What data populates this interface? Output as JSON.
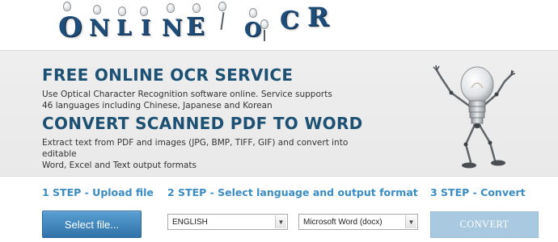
{
  "logo": {
    "letters": [
      "O",
      "N",
      "L",
      "I",
      "N",
      "E",
      "O",
      "C",
      "R"
    ]
  },
  "hero": {
    "title1": "FREE ONLINE OCR SERVICE",
    "text1_line1": "Use Optical Character Recognition software online. Service supports",
    "text1_line2": "46 languages including Chinese, Japanese and Korean",
    "title2": "CONVERT SCANNED PDF TO WORD",
    "text2_line1": "Extract text from PDF and images (JPG, BMP, TIFF, GIF) and convert into editable",
    "text2_line2": "Word, Excel and Text output formats"
  },
  "steps": {
    "step1_title": "1 STEP - Upload file",
    "step1_button": "Select file...",
    "step2_title": "2 STEP - Select language and output format",
    "language_selected": "ENGLISH",
    "format_selected": "Microsoft Word (docx)",
    "step3_title": "3 STEP - Convert",
    "convert_button": "CONVERT"
  },
  "colors": {
    "title_blue": "#1d5173",
    "step_blue": "#3a8cc4",
    "button_blue": "#2f73aa",
    "convert_disabled": "#a8c9e0",
    "hero_bg": "#eeeeee"
  },
  "icons": {
    "mascot": "lightbulb-robot-icon",
    "dropdown": "chevron-down-icon"
  }
}
